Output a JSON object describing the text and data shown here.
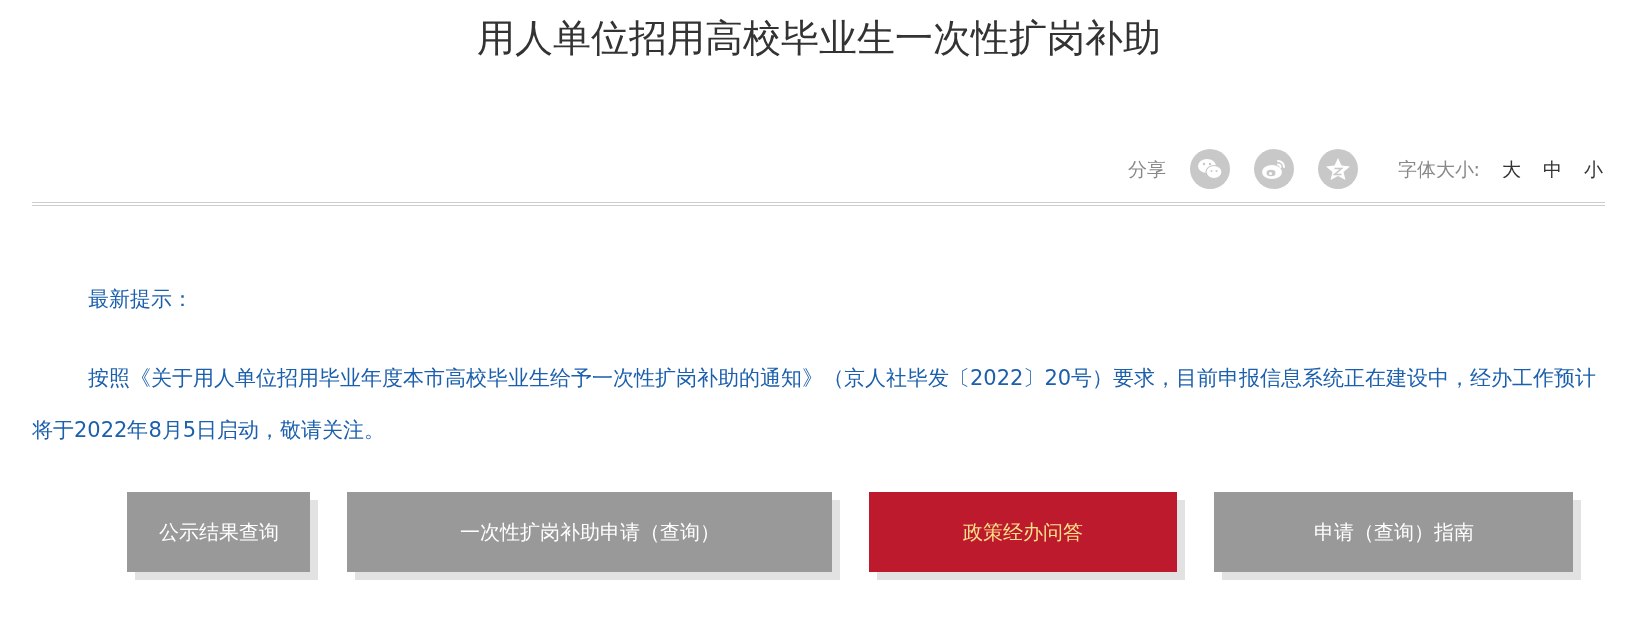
{
  "title": "用人单位招用高校毕业生一次性扩岗补助",
  "share": {
    "label": "分享",
    "icons": [
      {
        "kind": "wechat"
      },
      {
        "kind": "weibo"
      },
      {
        "kind": "qzone"
      }
    ]
  },
  "font_size": {
    "label": "字体大小:",
    "options": [
      "大",
      "中",
      "小"
    ]
  },
  "notice": {
    "heading": "最新提示：",
    "body": "按照《关于用人单位招用毕业年度本市高校毕业生给予一次性扩岗补助的通知》（京人社毕发〔2022〕20号）要求，目前申报信息系统正在建设中，经办工作预计将于2022年8月5日启动，敬请关注。"
  },
  "buttons": [
    {
      "label": "公示结果查询",
      "selected": false
    },
    {
      "label": "一次性扩岗补助申请（查询）",
      "selected": false
    },
    {
      "label": "政策经办问答",
      "selected": true
    },
    {
      "label": "申请（查询）指南",
      "selected": false
    }
  ]
}
